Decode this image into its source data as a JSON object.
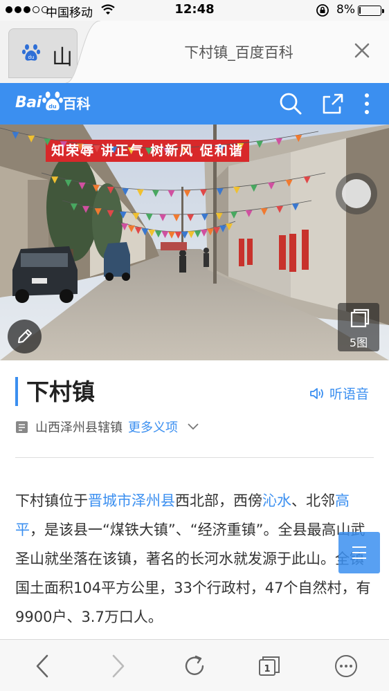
{
  "status_bar": {
    "carrier": "中国移动",
    "time": "12:48",
    "battery_percent": "8%",
    "battery_level": 0.08,
    "signal_bars": 3,
    "signal_total": 5
  },
  "browser_tab": {
    "left_tab_text": "山",
    "active_tab_title": "下村镇_百度百科"
  },
  "header": {
    "logo_text_1": "Bai",
    "logo_text_2": "百科",
    "background_color": "#3b8ff0"
  },
  "hero": {
    "banner_text": "知荣辱 讲正气 树新风 促和谐",
    "gallery_count": "5图"
  },
  "entry": {
    "title": "下村镇",
    "listen_label": "听语音",
    "polysemy_current": "山西泽州县辖镇",
    "polysemy_more": "更多义项"
  },
  "summary": {
    "s1": "下村镇位于",
    "link_jincheng": "晋城市",
    "link_zezhou": "泽州县",
    "s2": "西北部，西傍",
    "link_qinshui": "沁水",
    "s3": "、北邻",
    "link_gaoping": "高平",
    "s4": "，是该县一“煤铁大镇”、“经济重镇”。全县最高山武圣山就坐落在该镇，著名的长河水就发源于此山。全镇国土面积104平方公里，33个行政村，47个自然村，有9900户、3.7万口人。"
  },
  "toolbar": {
    "tabs_count": "1"
  },
  "icons": {
    "tab_favicon": "baidu-paw-icon",
    "close": "close-icon",
    "search": "search-icon",
    "share": "share-icon",
    "more": "more-vertical-icon",
    "edit": "pencil-icon",
    "gallery": "gallery-icon",
    "listen": "speaker-icon",
    "polysemy": "document-icon",
    "toc": "list-icon",
    "back": "back-icon",
    "forward": "forward-icon",
    "refresh": "refresh-icon",
    "tabs": "tabs-icon",
    "menu": "menu-icon"
  }
}
